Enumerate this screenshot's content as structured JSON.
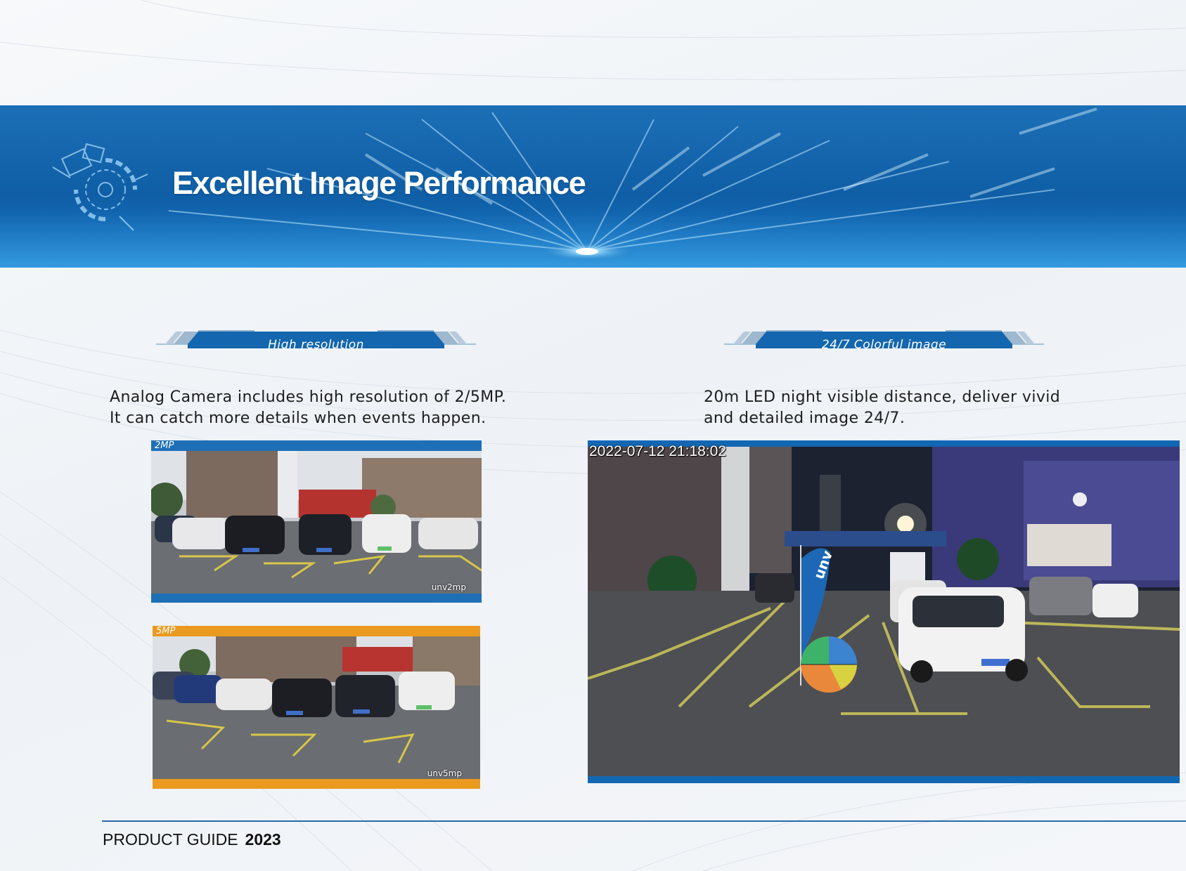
{
  "banner": {
    "title": "Excellent Image Performance"
  },
  "sections": {
    "left": {
      "tag": "High resolution",
      "lines": [
        "Analog Camera includes high resolution of 2/5MP.",
        "It can catch more details when events happen."
      ],
      "cameras": [
        {
          "label": "2MP",
          "watermark": "unv2mp",
          "accent": "#1e6fb6"
        },
        {
          "label": "5MP",
          "watermark": "unv5mp",
          "accent": "#eb9a20"
        }
      ]
    },
    "right": {
      "tag": "24/7 Colorful image",
      "lines": [
        "20m LED night visible distance, deliver vivid",
        "and detailed image 24/7."
      ],
      "camera": {
        "timestamp": "2022-07-12  21:18:02",
        "flag_text": "unv",
        "accent": "#1267b3"
      }
    }
  },
  "footer": {
    "label": "PRODUCT GUIDE",
    "year": "2023"
  },
  "colors": {
    "brand_blue": "#0f5ea6",
    "orange": "#eb9a20"
  }
}
